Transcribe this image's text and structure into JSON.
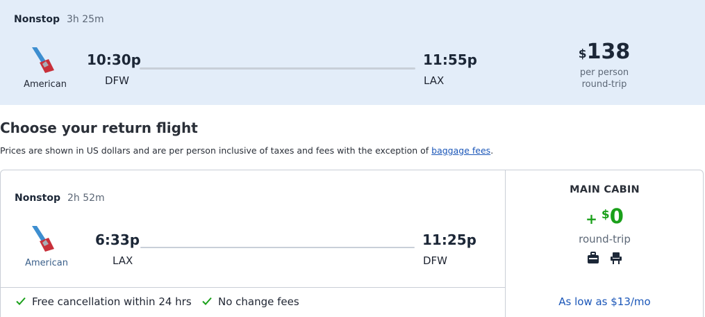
{
  "selected_flight": {
    "stops_label": "Nonstop",
    "duration": "3h 25m",
    "airline": "American",
    "depart_time": "10:30p",
    "depart_airport": "DFW",
    "arrive_time": "11:55p",
    "arrive_airport": "LAX",
    "price_currency": "$",
    "price_amount": "138",
    "price_line1": "per person",
    "price_line2": "round-trip"
  },
  "section": {
    "heading": "Choose your return flight",
    "disclaimer_text": "Prices are shown in US dollars and are per person inclusive of taxes and fees with the exception of ",
    "disclaimer_link": "baggage fees",
    "disclaimer_end": "."
  },
  "return_flight": {
    "stops_label": "Nonstop",
    "duration": "2h 52m",
    "airline": "American",
    "depart_time": "6:33p",
    "depart_airport": "LAX",
    "arrive_time": "11:25p",
    "arrive_airport": "DFW",
    "features": [
      "Free cancellation within 24 hrs",
      "No change fees"
    ],
    "cabin": {
      "title": "MAIN CABIN",
      "plus": "+",
      "price_currency": "$",
      "price_amount": "0",
      "price_sub": "round-trip",
      "icons": [
        "carry-on-bag-icon",
        "seat-icon"
      ],
      "financing": "As low as $13/mo"
    }
  },
  "colors": {
    "selected_bg": "#e3edf9",
    "price_green": "#1aa01a",
    "link_blue": "#1a56b8",
    "airline_red": "#c8303a",
    "airline_blue": "#3d8ed0"
  }
}
